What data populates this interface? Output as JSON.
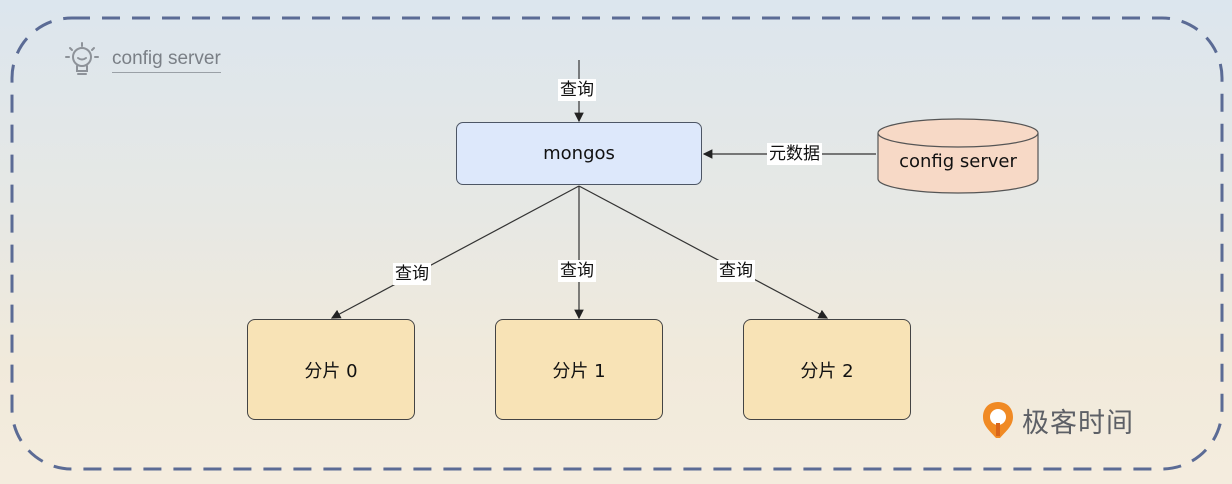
{
  "hint": {
    "label": "config server"
  },
  "mongos": {
    "label": "mongos"
  },
  "config_server": {
    "label": "config server"
  },
  "edges": {
    "query_in": "查询",
    "metadata": "元数据",
    "query_shard0": "查询",
    "query_shard1": "查询",
    "query_shard2": "查询"
  },
  "shards": [
    {
      "label": "分片 0"
    },
    {
      "label": "分片 1"
    },
    {
      "label": "分片 2"
    }
  ],
  "brand": {
    "name": "极客时间"
  },
  "colors": {
    "frame_dash": "#5b6b95",
    "mongos_fill": "#dde8fb",
    "shard_fill": "#f8e3b6",
    "cylinder_fill": "#f7d9c6",
    "brand_orange": "#f08a24"
  }
}
